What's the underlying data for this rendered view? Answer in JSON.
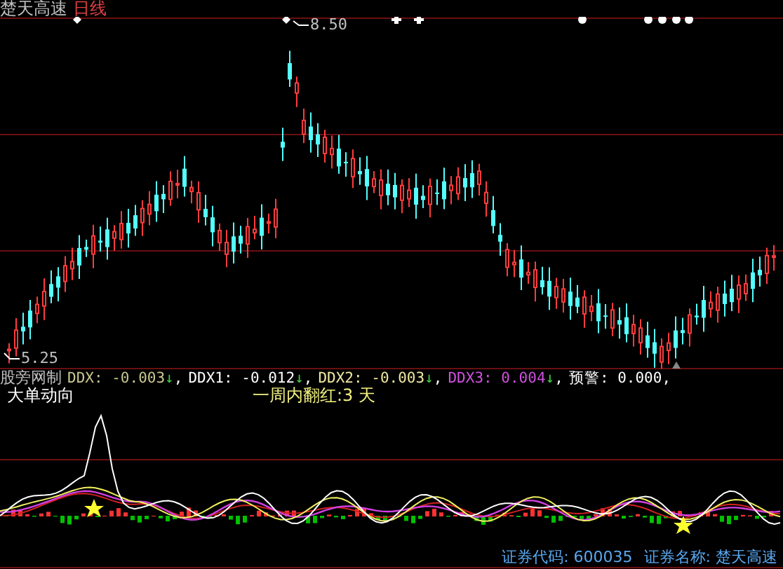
{
  "header": {
    "stock_name": "楚天高速",
    "period": "日线"
  },
  "main_chart": {
    "high_label": "8.50",
    "low_label": "5.25"
  },
  "indicator": {
    "name": "股旁网制",
    "items": [
      {
        "label": "DDX:",
        "value": "-0.003",
        "arrow": "↓",
        "separator": ",",
        "color": "#c8c890"
      },
      {
        "label": "DDX1:",
        "value": "-0.012",
        "arrow": "↓",
        "separator": ",",
        "color": "#ffffff"
      },
      {
        "label": "DDX2:",
        "value": "-0.003",
        "arrow": "↓",
        "separator": ",",
        "color": "#f0e8a0"
      },
      {
        "label": "DDX3:",
        "value": "0.004",
        "arrow": "↓",
        "separator": ",",
        "color": "#d050e0"
      },
      {
        "label": "预警:",
        "value": "0.000",
        "separator": ",",
        "color": "#ffffff"
      }
    ]
  },
  "lower_panel": {
    "title": "大单动向",
    "note": "一周内翻红:3 天"
  },
  "footer": {
    "code": "证券代码: 600035",
    "name": "证券名称: 楚天高速"
  }
}
